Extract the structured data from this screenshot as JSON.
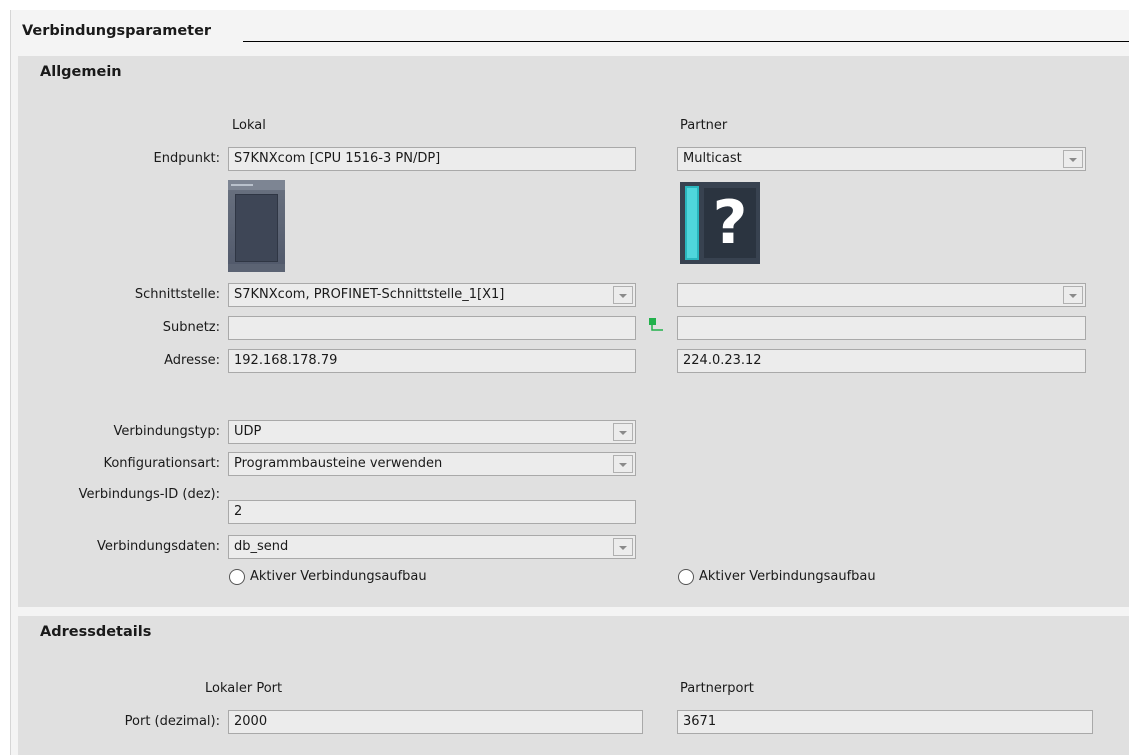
{
  "section": {
    "title": "Verbindungsparameter"
  },
  "allgemein": {
    "title": "Allgemein",
    "col_local": "Lokal",
    "col_partner": "Partner",
    "endpunkt": {
      "label": "Endpunkt:",
      "local": "S7KNXcom [CPU 1516-3 PN/DP]",
      "partner": "Multicast"
    },
    "schnittstelle": {
      "label": "Schnittstelle:",
      "local": "S7KNXcom, PROFINET-Schnittstelle_1[X1]",
      "partner": ""
    },
    "subnetz": {
      "label": "Subnetz:",
      "local": "",
      "partner": ""
    },
    "adresse": {
      "label": "Adresse:",
      "local": "192.168.178.79",
      "partner": "224.0.23.12"
    },
    "verbindungstyp": {
      "label": "Verbindungstyp:",
      "value": "UDP"
    },
    "konfigurationsart": {
      "label": "Konfigurationsart:",
      "value": "Programmbausteine verwenden"
    },
    "verbindungs_id": {
      "label": "Verbindungs-ID (dez):",
      "value": "2"
    },
    "verbindungsdaten": {
      "label": "Verbindungsdaten:",
      "value": "db_send"
    },
    "radio_local": {
      "label": "Aktiver Verbindungsaufbau",
      "checked": false
    },
    "radio_partner": {
      "label": "Aktiver Verbindungsaufbau",
      "checked": false
    },
    "icons": {
      "local_device": "cpu-module-icon",
      "partner_device": "unknown-device-icon",
      "subnet": "network-connection-icon"
    }
  },
  "adressdetails": {
    "title": "Adressdetails",
    "col_local": "Lokaler Port",
    "col_partner": "Partnerport",
    "port": {
      "label": "Port (dezimal):",
      "local": "2000",
      "partner": "3671"
    }
  },
  "colors": {
    "group_bg": "#e0e0e0",
    "field_bg": "#ececec",
    "accent_cyan": "#4fd6dc",
    "net_green": "#22b14c"
  }
}
